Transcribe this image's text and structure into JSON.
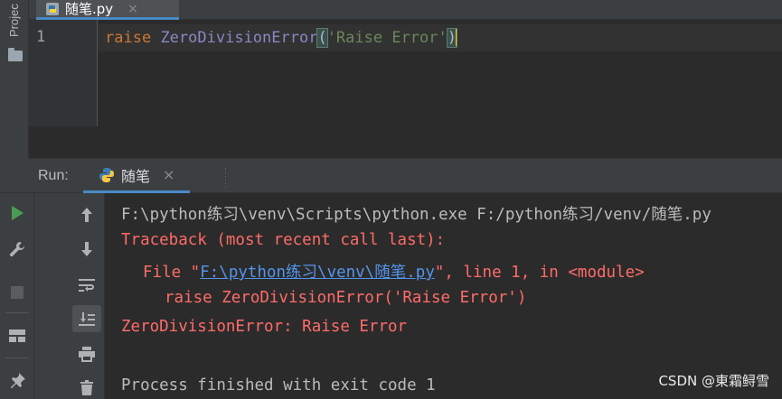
{
  "project_strip": {
    "label": "Projec"
  },
  "editor": {
    "tab": {
      "label": "随笔.py",
      "close": "×"
    },
    "line_number": "1",
    "code": {
      "keyword": "raise",
      "class_name": "ZeroDivisionError",
      "open_paren": "(",
      "string": "'Raise Error'",
      "close_paren": ")"
    }
  },
  "run": {
    "title": "Run:",
    "tab": {
      "label": "随笔",
      "close": "×"
    },
    "toolbar_left": [
      "run-icon",
      "wrench-icon",
      "stop-icon",
      "layout-icon",
      "pin-icon"
    ],
    "toolbar_right": [
      "arrow-up-icon",
      "arrow-down-icon",
      "soft-wrap-icon",
      "scroll-to-end-icon",
      "print-icon",
      "trash-icon"
    ]
  },
  "console": {
    "command": "F:\\python练习\\venv\\Scripts\\python.exe F:/python练习/venv/随笔.py",
    "traceback_header": "Traceback (most recent call last):",
    "file_prefix": "File \"",
    "file_link": "F:\\python练习\\venv\\随笔.py",
    "file_suffix": "\", line 1, in <module>",
    "code_line": "raise ZeroDivisionError('Raise Error')",
    "error_line": "ZeroDivisionError: Raise Error",
    "exit_line": "Process finished with exit code 1"
  },
  "watermark": "CSDN @東霜鲟雪",
  "colors": {
    "background": "#2b2b2b",
    "keyword": "#cc7832",
    "class_name": "#8888c6",
    "string": "#6a8759",
    "error_text": "#ff6b68",
    "link": "#5394ec",
    "run_green": "#499c54"
  }
}
